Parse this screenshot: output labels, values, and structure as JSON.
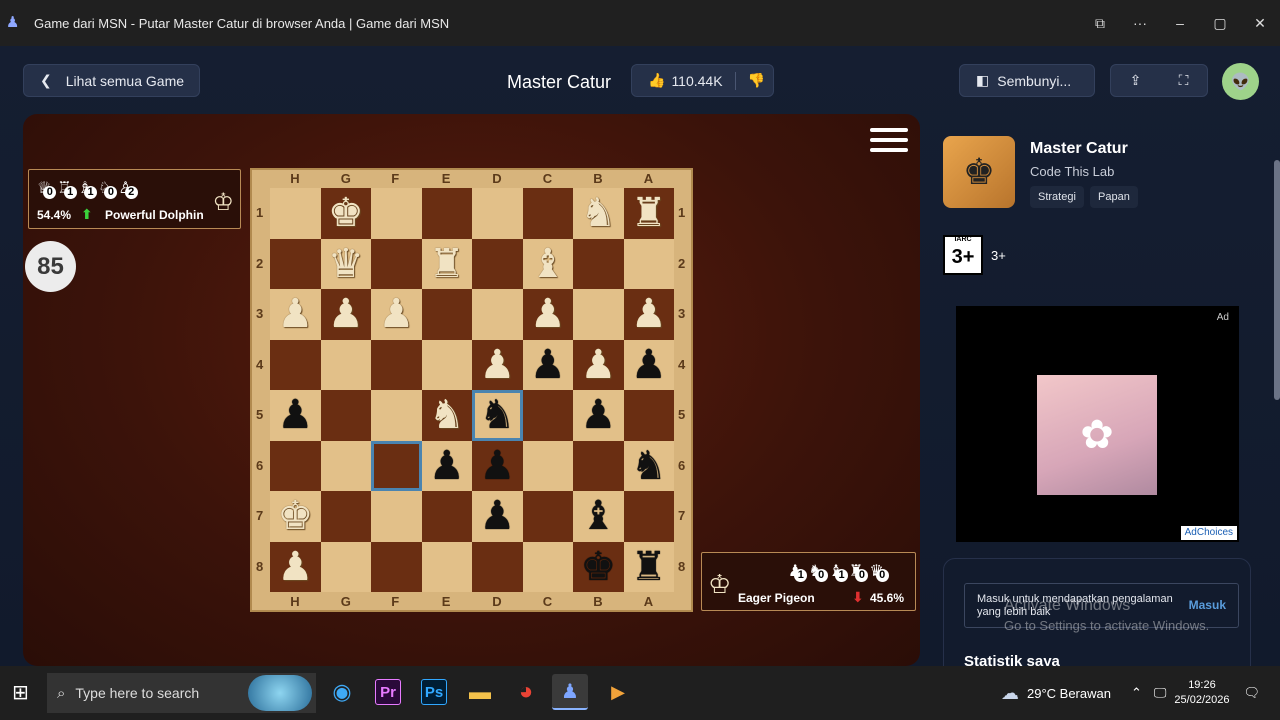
{
  "window": {
    "title": "Game dari MSN - Putar Master Catur di browser Anda | Game dari MSN",
    "controls": [
      "⧉",
      "···",
      "–",
      "▢",
      "✕"
    ]
  },
  "header": {
    "back_label": "Lihat semua Game",
    "game_title": "Master Catur",
    "likes": "110.44K",
    "hide_label": "Sembunyi..."
  },
  "game": {
    "top_player": {
      "name": "Powerful Dolphin",
      "percent": "54.4%",
      "captured": [
        {
          "glyph": "♕",
          "count": "0"
        },
        {
          "glyph": "♖",
          "count": "1"
        },
        {
          "glyph": "♗",
          "count": "1"
        },
        {
          "glyph": "♘",
          "count": "0"
        },
        {
          "glyph": "♙",
          "count": "2"
        }
      ]
    },
    "bottom_player": {
      "name": "Eager Pigeon",
      "percent": "45.6%",
      "captured": [
        {
          "glyph": "♟",
          "count": "1"
        },
        {
          "glyph": "♞",
          "count": "0"
        },
        {
          "glyph": "♝",
          "count": "1"
        },
        {
          "glyph": "♜",
          "count": "0"
        },
        {
          "glyph": "♛",
          "count": "0"
        }
      ]
    },
    "timer": "85",
    "files": [
      "H",
      "G",
      "F",
      "E",
      "D",
      "C",
      "B",
      "A"
    ],
    "ranks": [
      "1",
      "2",
      "3",
      "4",
      "5",
      "6",
      "7",
      "8"
    ],
    "board": [
      [
        "",
        "wK",
        "",
        "",
        "",
        "",
        "wN",
        "wR"
      ],
      [
        "",
        "wQ",
        "",
        "wR",
        "",
        "wB",
        "",
        ""
      ],
      [
        "wP",
        "wP",
        "wP",
        "",
        "",
        "wP",
        "",
        "wP"
      ],
      [
        "",
        "",
        "",
        "",
        "wP",
        "bP",
        "wP",
        "bP"
      ],
      [
        "bP",
        "",
        "",
        "wN",
        "bN",
        "",
        "bP",
        ""
      ],
      [
        "",
        "",
        "",
        "bP",
        "bP",
        "",
        "",
        "bN"
      ],
      [
        "wK",
        "",
        "",
        "",
        "bP",
        "",
        "bB",
        ""
      ],
      [
        "wP",
        "",
        "",
        "",
        "",
        "",
        "bK",
        "bR"
      ]
    ]
  },
  "sidebar": {
    "app_name": "Master Catur",
    "developer": "Code This Lab",
    "tags": [
      "Strategi",
      "Papan"
    ],
    "iarc_label": "IARC",
    "iarc_rating": "3+",
    "age_text": "3+",
    "ad_label": "Ad",
    "adchoices": "AdChoices",
    "signin_text": "Masuk untuk mendapatkan pengalaman yang lebih baik",
    "signin_button": "Masuk",
    "stats_title": "Statistik saya"
  },
  "watermark": {
    "line1": "Activate Windows",
    "line2": "Go to Settings to activate Windows."
  },
  "taskbar": {
    "search_placeholder": "Type here to search",
    "weather": "29°C  Berawan",
    "time": "19:26",
    "date": "25/02/2026",
    "apps": [
      "Edge",
      "Pr",
      "Ps",
      "Files",
      "Chrome",
      "Games",
      "Media"
    ]
  }
}
